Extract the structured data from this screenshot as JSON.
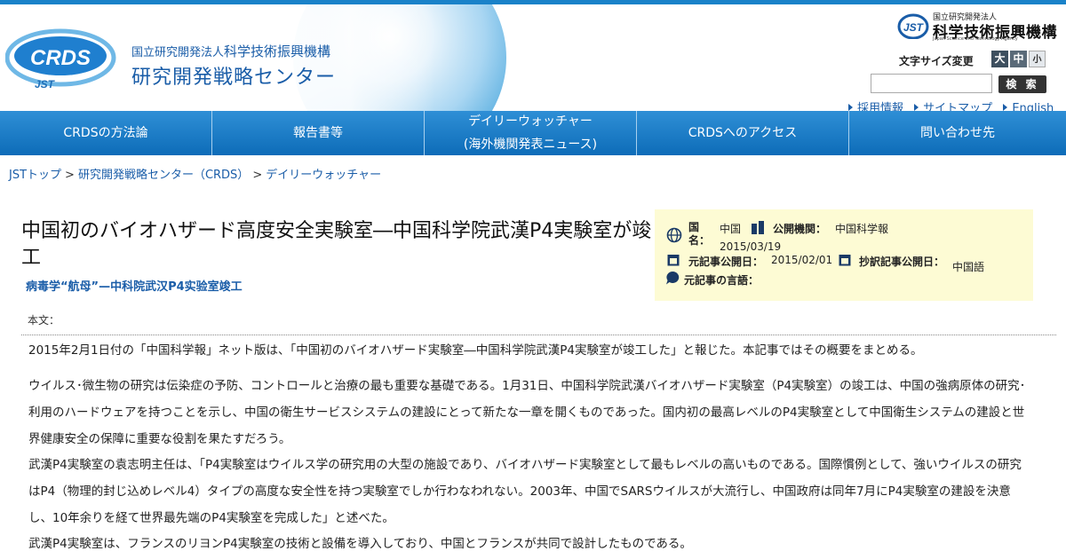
{
  "header": {
    "crds_logo_text": "CRDS",
    "crds_logo_sub": "JST",
    "org_prefix": "国立研究開発法人",
    "org_name": "科学技術振興機構",
    "center_name": "研究開発戦略センター",
    "jst_small": "国立研究開発法人",
    "jst_name": "科学技術振興機構",
    "jst_en": "Japan Science and Technology Agency",
    "jst_badge": "JST",
    "font_size_label": "文字サイズ変更",
    "font_size_large": "大",
    "font_size_mid": "中",
    "font_size_small": "小",
    "search_placeholder": "",
    "search_button": "検 索",
    "util_links": [
      "採用情報",
      "サイトマップ",
      "English"
    ]
  },
  "nav": {
    "items": [
      {
        "line1": "CRDSの方法論",
        "line2": ""
      },
      {
        "line1": "報告書等",
        "line2": ""
      },
      {
        "line1": "デイリーウォッチャー",
        "line2": "(海外機関発表ニュース)"
      },
      {
        "line1": "CRDSへのアクセス",
        "line2": ""
      },
      {
        "line1": "問い合わせ先",
        "line2": ""
      }
    ]
  },
  "breadcrumb": {
    "items": [
      "JSTトップ",
      "研究開発戦略センター（CRDS）",
      "デイリーウォッチャー"
    ],
    "separator": ">"
  },
  "article": {
    "title": "中国初のバイオハザード高度安全実験室―中国科学院武漢P4実験室が竣工",
    "subtitle": "病毒学“航母”—中科院武汉P4实验室竣工",
    "body_label": "本文：",
    "paragraphs": [
      "2015年2月1日付の「中国科学報」ネット版は、「中国初のバイオハザード実験室―中国科学院武漢P4実験室が竣工した」と報じた。本記事ではその概要をまとめる。",
      "ウイルス･微生物の研究は伝染症の予防、コントロールと治療の最も重要な基礎である。1月31日、中国科学院武漢バイオハザード実験室（P4実験室）の竣工は、中国の強病原体の研究･利用のハードウェアを持つことを示し、中国の衛生サービスシステムの建設にとって新たな一章を開くものであった。国内初の最高レベルのP4実験室として中国衛生システムの建設と世界健康安全の保障に重要な役割を果たすだろう。",
      "武漢P4実験室の袁志明主任は、「P4実験室はウイルス学の研究用の大型の施設であり、バイオハザード実験室として最もレベルの高いものである。国際慣例として、強いウイルスの研究はP4（物理的封じ込めレベル4）タイプの高度な安全性を持つ実験室でしか行わなわれない。2003年、中国でSARSウイルスが大流行し、中国政府は同年7月にP4実験室の建設を決意し、10年余りを経て世界最先端のP4実験室を完成した」と述べた。",
      "武漢P4実験室は、フランスのリヨンP4実験室の技術と設備を導入しており、中国とフランスが共同で設計したものである。"
    ]
  },
  "info_box": {
    "country_label": "国名：",
    "country_value": "中国",
    "publisher_label": "公開機関：",
    "publisher_value": "中国科学報",
    "release_date": "2015/03/19",
    "original_date_label": "元記事公開日：",
    "original_date_value": "2015/02/01",
    "translation_date_label": "抄訳記事公開日：",
    "language_label": "元記事の言語：",
    "language_value": "中国語"
  },
  "colors": {
    "brand_blue": "#1a5da8",
    "nav_blue": "#1473c0",
    "info_bg": "#fdfbd4"
  }
}
